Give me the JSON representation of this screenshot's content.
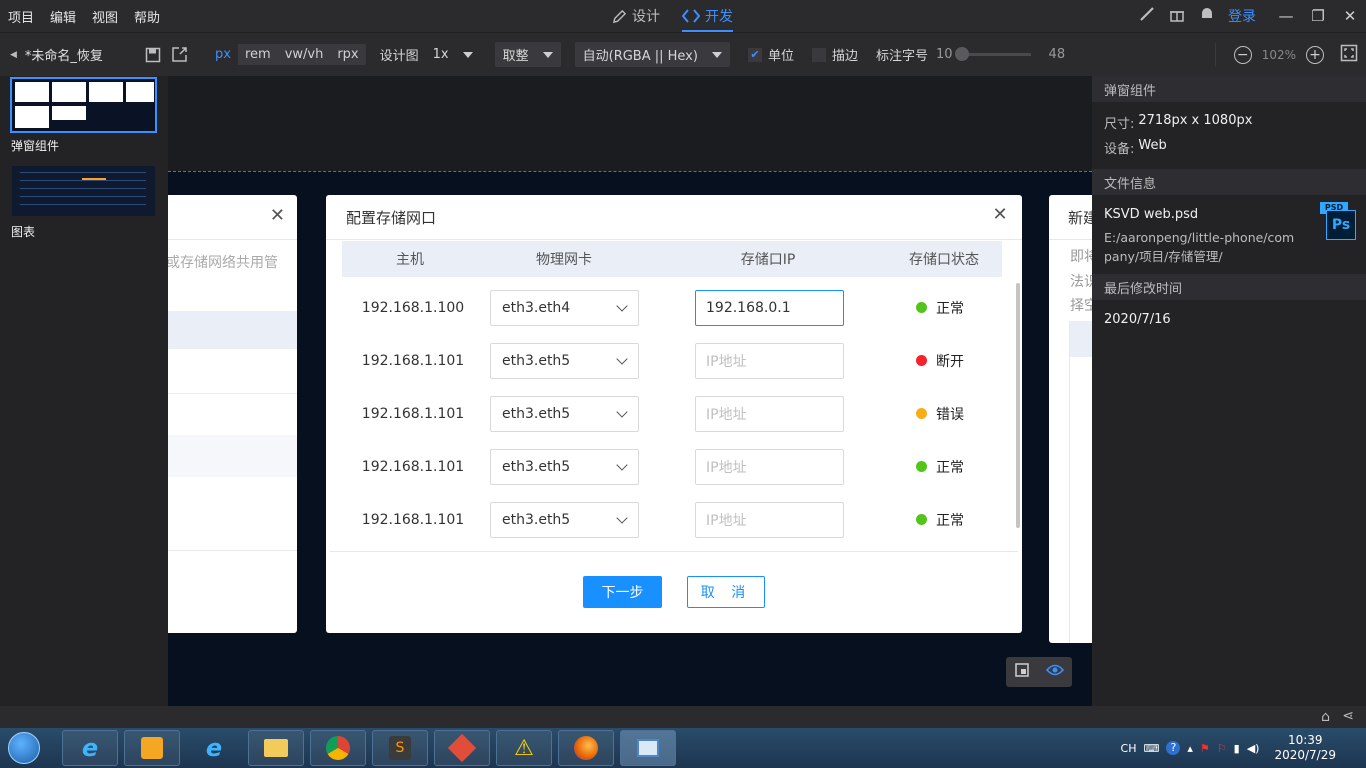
{
  "menu": [
    "项目",
    "编辑",
    "视图",
    "帮助"
  ],
  "modes": [
    {
      "label": "设计",
      "icon": "pen-icon",
      "active": false
    },
    {
      "label": "开发",
      "icon": "code-icon",
      "active": true
    }
  ],
  "topright": {
    "login": "登录"
  },
  "toolbar": {
    "doc_name": "*未命名_恢复",
    "units": [
      "px",
      "rem",
      "vw/vh",
      "rpx"
    ],
    "active_unit": "px",
    "design_label": "设计图",
    "design_scale": "1x",
    "rounding": "取整",
    "color_format": "自动(RGBA || Hex)",
    "unit_check_label": "单位",
    "unit_checked": true,
    "stroke_label": "描边",
    "stroke_checked": false,
    "font_label": "标注字号",
    "font_min": "10",
    "font_max": "48",
    "zoom": "102%"
  },
  "left_panel": {
    "artboards": [
      {
        "label": "弹窗组件",
        "selected": true
      },
      {
        "label": "图表",
        "selected": false
      }
    ]
  },
  "left_partial": {
    "text": "或存储网络共用管"
  },
  "right_partial": {
    "title": "新建",
    "lines": [
      "即将",
      "法识",
      "择空"
    ]
  },
  "dialog": {
    "title": "配置存储网口",
    "columns": [
      "主机",
      "物理网卡",
      "存储口IP",
      "存储口状态"
    ],
    "rows": [
      {
        "host": "192.168.1.100",
        "nic": "eth3.eth4",
        "ip": "192.168.0.1",
        "ip_placeholder": "IP地址",
        "focused": true,
        "status": "正常",
        "status_color": "#52c41a"
      },
      {
        "host": "192.168.1.101",
        "nic": "eth3.eth5",
        "ip": "",
        "ip_placeholder": "IP地址",
        "focused": false,
        "status": "断开",
        "status_color": "#f5222d"
      },
      {
        "host": "192.168.1.101",
        "nic": "eth3.eth5",
        "ip": "",
        "ip_placeholder": "IP地址",
        "focused": false,
        "status": "错误",
        "status_color": "#faad14"
      },
      {
        "host": "192.168.1.101",
        "nic": "eth3.eth5",
        "ip": "",
        "ip_placeholder": "IP地址",
        "focused": false,
        "status": "正常",
        "status_color": "#52c41a"
      },
      {
        "host": "192.168.1.101",
        "nic": "eth3.eth5",
        "ip": "",
        "ip_placeholder": "IP地址",
        "focused": false,
        "status": "正常",
        "status_color": "#52c41a"
      }
    ],
    "next_label": "下一步",
    "cancel_label": "取 消"
  },
  "right_panel": {
    "section1": "弹窗组件",
    "size_key": "尺寸:",
    "size_val": "2718px x 1080px",
    "device_key": "设备:",
    "device_val": "Web",
    "section2": "文件信息",
    "file_name": "KSVD web.psd",
    "file_path": "E:/aaronpeng/little-phone/company/项目/存储管理/",
    "psd_badge": "PSD",
    "ps_label": "Ps",
    "section3": "最后修改时间",
    "modified": "2020/7/16"
  },
  "taskbar": {
    "apps": [
      "ie-icon",
      "media-icon",
      "ie-icon",
      "explorer-icon",
      "chrome-icon",
      "sublime-icon",
      "git-icon",
      "warning-icon",
      "firefox-icon",
      "app-icon"
    ],
    "lang": "CH",
    "time": "10:39",
    "date": "2020/7/29"
  },
  "colors": {
    "accent": "#1890ff",
    "editor_accent": "#3c8fff"
  }
}
